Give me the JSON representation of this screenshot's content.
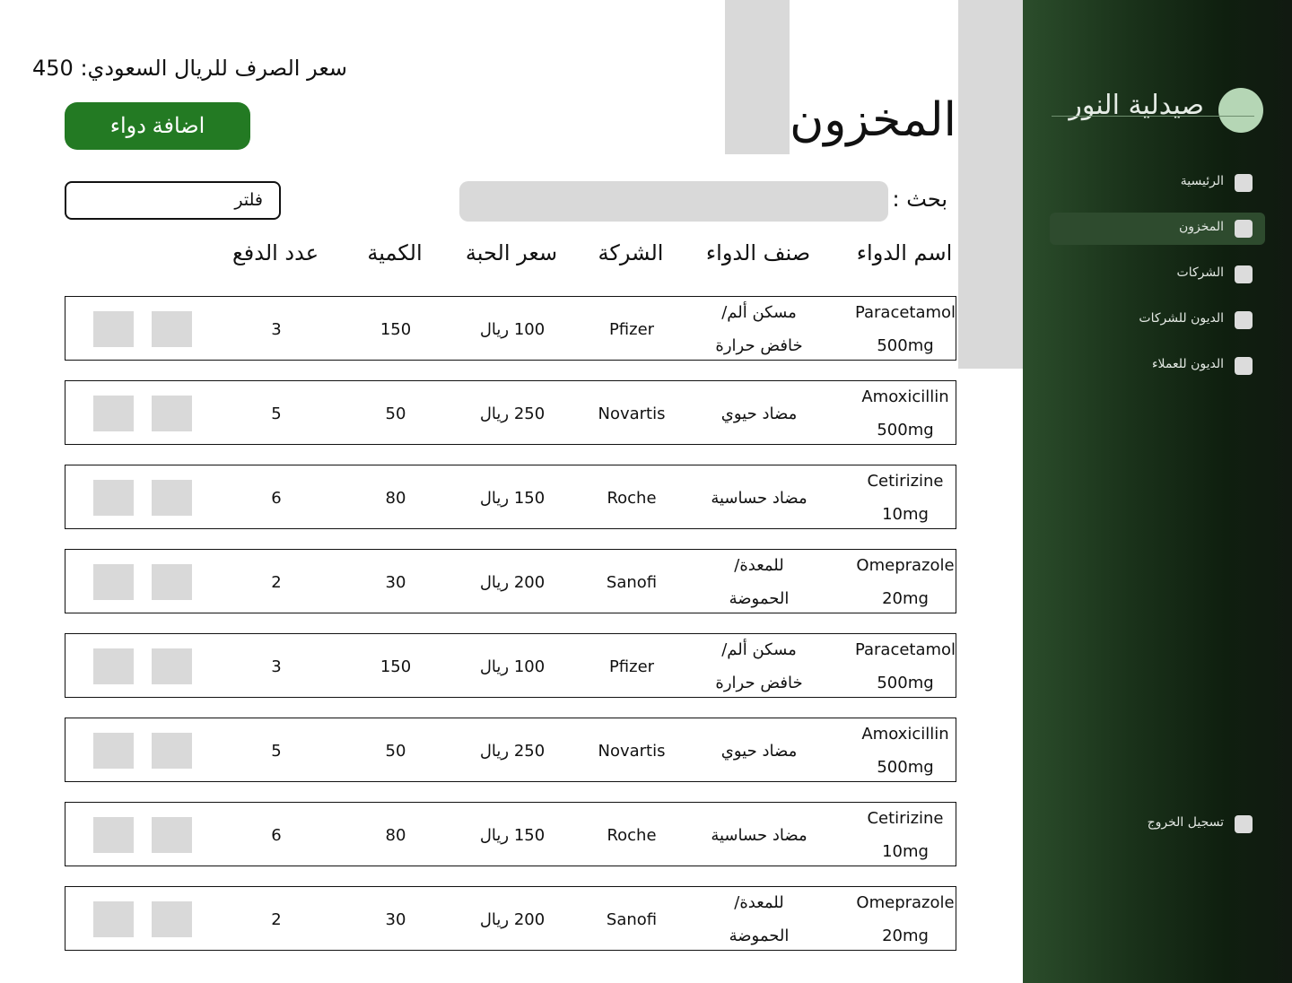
{
  "sidebar": {
    "brand": "صيدلية النور",
    "items": [
      {
        "label": "الرئيسية",
        "active": false
      },
      {
        "label": "المخزون",
        "active": true
      },
      {
        "label": "الشركات",
        "active": false
      },
      {
        "label": "الديون للشركات",
        "active": false
      },
      {
        "label": "الديون للعملاء",
        "active": false
      }
    ],
    "logout": "تسجيل الخروج"
  },
  "header": {
    "title": "المخزون",
    "exchange_rate": "سعر الصرف للريال السعودي: 450",
    "add_button": "اضافة دواء"
  },
  "search": {
    "label": "بحث :",
    "value": "",
    "filter_label": "فلتر"
  },
  "table": {
    "columns": [
      "اسم الدواء",
      "صنف الدواء",
      "الشركة",
      "سعر الحبة",
      "الكمية",
      "عدد الدفع"
    ],
    "rows": [
      {
        "name": [
          "Paracetamol",
          "500mg"
        ],
        "category": [
          "مسكن ألم/",
          "خافض حرارة"
        ],
        "company": "Pfizer",
        "price": "100 ريال",
        "quantity": "150",
        "payments": "3"
      },
      {
        "name": [
          "Amoxicillin",
          "500mg"
        ],
        "category": [
          "مضاد حيوي"
        ],
        "company": "Novartis",
        "price": "250 ريال",
        "quantity": "50",
        "payments": "5"
      },
      {
        "name": [
          "Cetirizine",
          "10mg"
        ],
        "category": [
          "مضاد حساسية"
        ],
        "company": "Roche",
        "price": "150 ريال",
        "quantity": "80",
        "payments": "6"
      },
      {
        "name": [
          "Omeprazole",
          "20mg"
        ],
        "category": [
          "للمعدة/",
          "الحموضة"
        ],
        "company": "Sanofi",
        "price": "200 ريال",
        "quantity": "30",
        "payments": "2"
      },
      {
        "name": [
          "Paracetamol",
          "500mg"
        ],
        "category": [
          "مسكن ألم/",
          "خافض حرارة"
        ],
        "company": "Pfizer",
        "price": "100 ريال",
        "quantity": "150",
        "payments": "3"
      },
      {
        "name": [
          "Amoxicillin",
          "500mg"
        ],
        "category": [
          "مضاد حيوي"
        ],
        "company": "Novartis",
        "price": "250 ريال",
        "quantity": "50",
        "payments": "5"
      },
      {
        "name": [
          "Cetirizine",
          "10mg"
        ],
        "category": [
          "مضاد حساسية"
        ],
        "company": "Roche",
        "price": "150 ريال",
        "quantity": "80",
        "payments": "6"
      },
      {
        "name": [
          "Omeprazole",
          "20mg"
        ],
        "category": [
          "للمعدة/",
          "الحموضة"
        ],
        "company": "Sanofi",
        "price": "200 ريال",
        "quantity": "30",
        "payments": "2"
      }
    ]
  },
  "colors": {
    "sidebar_start": "#2b4d2b",
    "sidebar_end": "#111a11",
    "accent": "#237a23",
    "placeholder_gray": "#d9d9d9"
  }
}
